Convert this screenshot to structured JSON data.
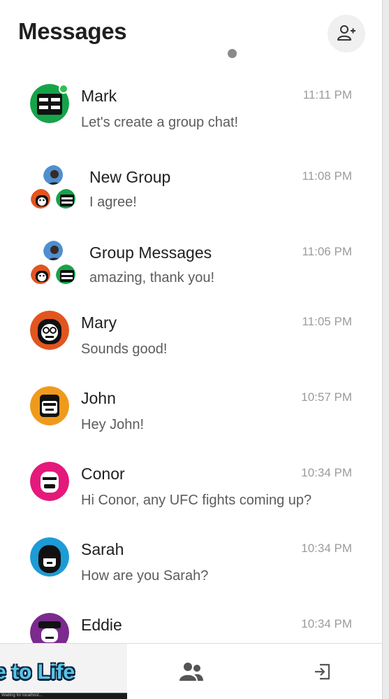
{
  "header": {
    "title": "Messages",
    "add_icon": "person-add-icon"
  },
  "conversations": [
    {
      "name": "Mark",
      "time": "11:11 PM",
      "preview": "Let's create a group chat!",
      "avatar_color": "#16a34a",
      "online": true
    },
    {
      "name": "New Group",
      "time": "11:08 PM",
      "preview": "I agree!",
      "group": true
    },
    {
      "name": "Group Messages",
      "time": "11:06 PM",
      "preview": "amazing, thank you!",
      "group": true
    },
    {
      "name": "Mary",
      "time": "11:05 PM",
      "preview": "Sounds good!",
      "avatar_color": "#e2551f"
    },
    {
      "name": "John",
      "time": "10:57 PM",
      "preview": "Hey John!",
      "avatar_color": "#f09a1c"
    },
    {
      "name": "Conor",
      "time": "10:34 PM",
      "preview": "Hi Conor, any UFC fights coming up?",
      "avatar_color": "#e4197b"
    },
    {
      "name": "Sarah",
      "time": "10:34 PM",
      "preview": "How are you Sarah?",
      "avatar_color": "#1d9bd7"
    },
    {
      "name": "Eddie",
      "time": "10:34 PM",
      "preview": "",
      "avatar_color": "#7b2a8e"
    }
  ],
  "bottom_nav": {
    "caption": "e to Life",
    "status_text": "Waiting for localhost...",
    "contacts_icon": "people-icon",
    "logout_icon": "logout-icon"
  },
  "colors": {
    "online": "#2fbf53",
    "caption": "#58c7e8"
  }
}
